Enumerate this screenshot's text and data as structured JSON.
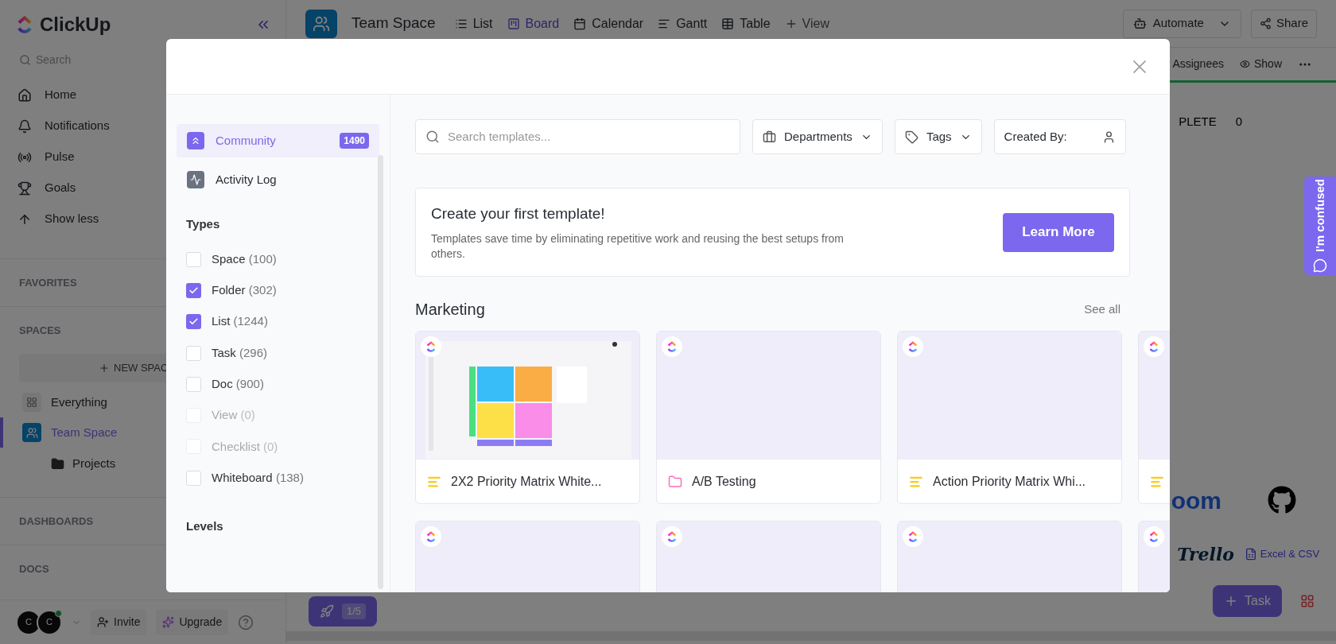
{
  "sidebar": {
    "logo": "ClickUp",
    "search": {
      "placeholder": "Search"
    },
    "nav": [
      {
        "label": "Home",
        "kind": "home"
      },
      {
        "label": "Notifications",
        "kind": "bell"
      },
      {
        "label": "Pulse",
        "kind": "pulse"
      },
      {
        "label": "Goals",
        "kind": "trophy"
      },
      {
        "label": "Show less",
        "kind": "up"
      }
    ],
    "favorites_heading": "FAVORITES",
    "spaces_heading": "SPACES",
    "new_space": "NEW SPAC",
    "spaces": [
      {
        "label": "Everything",
        "kind": "everything",
        "selected": false
      },
      {
        "label": "Team Space",
        "kind": "team",
        "selected": true,
        "children": [
          {
            "label": "Projects"
          }
        ]
      }
    ],
    "dashboards_heading": "DASHBOARDS",
    "docs_heading": "DOCS",
    "footer": {
      "avatars": [
        "C",
        "C"
      ],
      "online": true,
      "invite": "Invite",
      "upgrade": "Upgrade"
    }
  },
  "header": {
    "space": "Team Space",
    "views": [
      {
        "label": "List",
        "kind": "list",
        "selected": false
      },
      {
        "label": "Board",
        "kind": "board",
        "selected": true
      },
      {
        "label": "Calendar",
        "kind": "calendar",
        "selected": false
      },
      {
        "label": "Gantt",
        "kind": "gantt",
        "selected": false
      },
      {
        "label": "Table",
        "kind": "table",
        "selected": false
      }
    ],
    "add_view": "View",
    "automate": "Automate",
    "share": "Share"
  },
  "toolbar": {
    "assignees": "Assignees",
    "show": "Show"
  },
  "board_column": {
    "title": "PLETE",
    "count": "0"
  },
  "integrations": [
    {
      "kind": "wordmark",
      "label": "oom"
    },
    {
      "kind": "github"
    },
    {
      "kind": "script",
      "label": "Trello"
    },
    {
      "kind": "file",
      "label": "Excel & CSV"
    }
  ],
  "task_button": "Task",
  "onboarding": {
    "progress": "1/5"
  },
  "help_tab": "I'm confused",
  "modal": {
    "nav": [
      {
        "label": "Community",
        "kind": "community",
        "badge": "1490",
        "selected": true
      },
      {
        "label": "Activity Log",
        "kind": "activity",
        "selected": false
      }
    ],
    "types_heading": "Types",
    "types": [
      {
        "label": "Space",
        "count": "(100)",
        "checked": false,
        "disabled": false
      },
      {
        "label": "Folder",
        "count": "(302)",
        "checked": true,
        "disabled": false
      },
      {
        "label": "List",
        "count": "(1244)",
        "checked": true,
        "disabled": false
      },
      {
        "label": "Task",
        "count": "(296)",
        "checked": false,
        "disabled": false
      },
      {
        "label": "Doc",
        "count": "(900)",
        "checked": false,
        "disabled": false
      },
      {
        "label": "View",
        "count": "(0)",
        "checked": false,
        "disabled": true
      },
      {
        "label": "Checklist",
        "count": "(0)",
        "checked": false,
        "disabled": true
      },
      {
        "label": "Whiteboard",
        "count": "(138)",
        "checked": false,
        "disabled": false
      }
    ],
    "levels_heading": "Levels",
    "search": {
      "placeholder": "Search templates..."
    },
    "filters": [
      {
        "label": "Departments",
        "kind": "briefcase"
      },
      {
        "label": "Tags",
        "kind": "tag"
      },
      {
        "label": "Created By:",
        "kind": "person"
      }
    ],
    "banner": {
      "title": "Create your first template!",
      "text": "Templates save time by eliminating repetitive work and reusing the best setups from others.",
      "button": "Learn More"
    },
    "section": {
      "title": "Marketing",
      "link": "See all"
    },
    "cards": [
      {
        "title": "2X2 Priority Matrix White...",
        "kind": "lines",
        "thumbnail": true
      },
      {
        "title": "A/B Testing",
        "kind": "folder",
        "thumbnail": false
      },
      {
        "title": "Action Priority Matrix Whi...",
        "kind": "lines",
        "thumbnail": false
      },
      {
        "kind": "lines",
        "thumbnail": false
      }
    ],
    "more_cards": [
      {
        "thumbnail": false
      },
      {
        "thumbnail": false
      },
      {
        "thumbnail": false
      },
      {
        "thumbnail": false
      }
    ]
  }
}
